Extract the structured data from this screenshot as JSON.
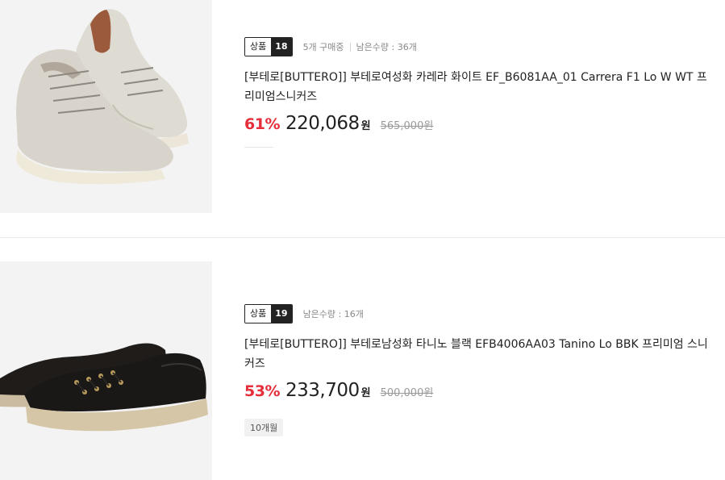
{
  "products": [
    {
      "badge_label": "상품",
      "badge_number": "18",
      "purchase_count": "5개 구매중",
      "remaining": "남은수량 : 36개",
      "title": "[부테로[BUTTERO]] 부테로여성화 카레라 화이트 EF_B6081AA_01 Carrera F1 Lo W WT 프리미엄스니커즈",
      "discount_rate": "61%",
      "sale_price": "220,068",
      "currency": "원",
      "original_price": "565,000원",
      "image_icon": "white-leather-sneakers-image"
    },
    {
      "badge_label": "상품",
      "badge_number": "19",
      "remaining": "남은수량 : 16개",
      "title": "[부테로[BUTTERO]] 부테로남성화 타니노 블랙 EFB4006AA03 Tanino Lo BBK 프리미엄 스니커즈",
      "discount_rate": "53%",
      "sale_price": "233,700",
      "currency": "원",
      "original_price": "500,000원",
      "tag": "10개월",
      "image_icon": "black-leather-sneakers-image"
    }
  ],
  "colors": {
    "discount": "#e52e3a",
    "badge_bg": "#222222",
    "thumb_bg": "#f3f3f3"
  }
}
